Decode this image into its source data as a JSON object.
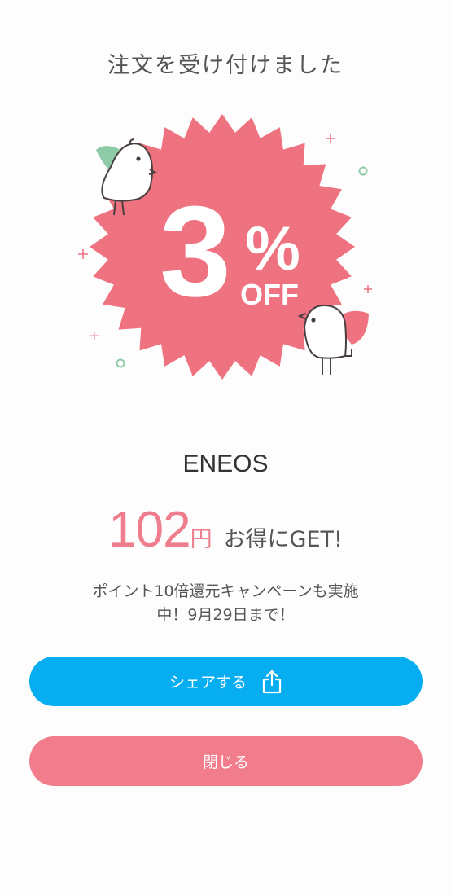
{
  "page_title": "注文を受け付けました",
  "hero": {
    "discount_number": "3",
    "discount_percent": "%",
    "discount_off": "OFF"
  },
  "merchant_name": "ENEOS",
  "reward": {
    "amount": "102",
    "currency": "円",
    "suffix": "お得にGET!"
  },
  "campaign_text_line1": "ポイント10倍還元キャンペーンも実施",
  "campaign_text_line2": "中！9月29日まで！",
  "buttons": {
    "share_label": "シェアする",
    "close_label": "閉じる"
  },
  "colors": {
    "badge": "#ef7281",
    "share_button": "#06adf0",
    "close_button": "#f07c8c",
    "amount": "#ee7e8e",
    "bird_green": "#8fcaa6",
    "bird_red": "#ef7281"
  },
  "icons": {
    "share": "share-icon"
  }
}
